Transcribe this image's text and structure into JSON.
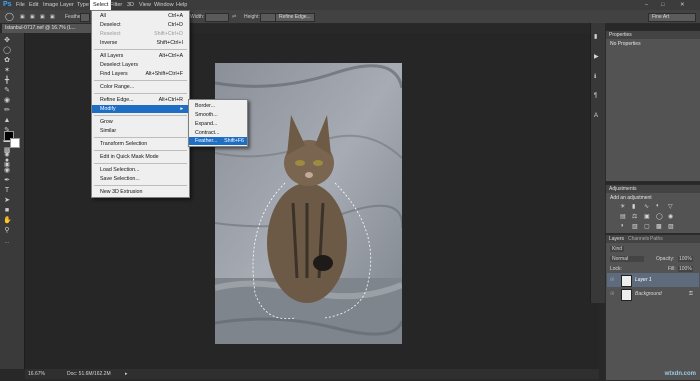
{
  "app": {
    "logo": "Ps"
  },
  "menubar": [
    "File",
    "Edit",
    "Image",
    "Layer",
    "Type",
    "Select",
    "Filter",
    "3D",
    "View",
    "Window",
    "Help"
  ],
  "workspace": "Fine Art",
  "options": {
    "feather_label": "Feather:",
    "feather_value": "0 px",
    "width_label": "Width:",
    "height_label": "Height:",
    "refine_edge": "Refine Edge..."
  },
  "document": {
    "tab_title": "Istanbul-0717.nef @ 16.7% (L...",
    "zoom": "16.67%",
    "doc_info": "Doc: 51.6M/162.2M"
  },
  "select_menu": [
    {
      "label": "All",
      "shortcut": "Ctrl+A"
    },
    {
      "label": "Deselect",
      "shortcut": "Ctrl+D"
    },
    {
      "label": "Reselect",
      "shortcut": "Shift+Ctrl+D",
      "disabled": true
    },
    {
      "label": "Inverse",
      "shortcut": "Shift+Ctrl+I"
    },
    {
      "label": "All Layers",
      "shortcut": "Alt+Ctrl+A"
    },
    {
      "label": "Deselect Layers",
      "shortcut": ""
    },
    {
      "label": "Find Layers",
      "shortcut": "Alt+Shift+Ctrl+F"
    },
    {
      "label": "Color Range...",
      "shortcut": ""
    },
    {
      "label": "Refine Edge...",
      "shortcut": "Alt+Ctrl+R"
    },
    {
      "label": "Modify",
      "shortcut": "▸",
      "highlight": true
    },
    {
      "label": "Grow",
      "shortcut": ""
    },
    {
      "label": "Similar",
      "shortcut": ""
    },
    {
      "label": "Transform Selection",
      "shortcut": ""
    },
    {
      "label": "Edit in Quick Mask Mode",
      "shortcut": ""
    },
    {
      "label": "Load Selection...",
      "shortcut": ""
    },
    {
      "label": "Save Selection...",
      "shortcut": ""
    },
    {
      "label": "New 3D Extrusion",
      "shortcut": ""
    }
  ],
  "modify_menu": [
    {
      "label": "Border...",
      "shortcut": ""
    },
    {
      "label": "Smooth...",
      "shortcut": ""
    },
    {
      "label": "Expand...",
      "shortcut": ""
    },
    {
      "label": "Contract...",
      "shortcut": ""
    },
    {
      "label": "Feather...",
      "shortcut": "Shift+F6",
      "highlight": true
    }
  ],
  "properties": {
    "title": "Properties",
    "content": "No Properties"
  },
  "adjustments": {
    "title": "Adjustments",
    "content": "Add an adjustment"
  },
  "layers_panel": {
    "tabs": [
      "Layers",
      "Channels",
      "Paths"
    ],
    "kind": "Kind",
    "blend_mode": "Normal",
    "opacity_label": "Opacity:",
    "opacity": "100%",
    "lock_label": "Lock:",
    "fill_label": "Fill:",
    "fill": "100%",
    "layers": [
      {
        "name": "Layer 1",
        "selected": true
      },
      {
        "name": "Background",
        "selected": false
      }
    ]
  },
  "watermark": "wtxdn.com",
  "colors": {
    "accent": "#1e6ec4",
    "logo": "#39a5f4"
  }
}
